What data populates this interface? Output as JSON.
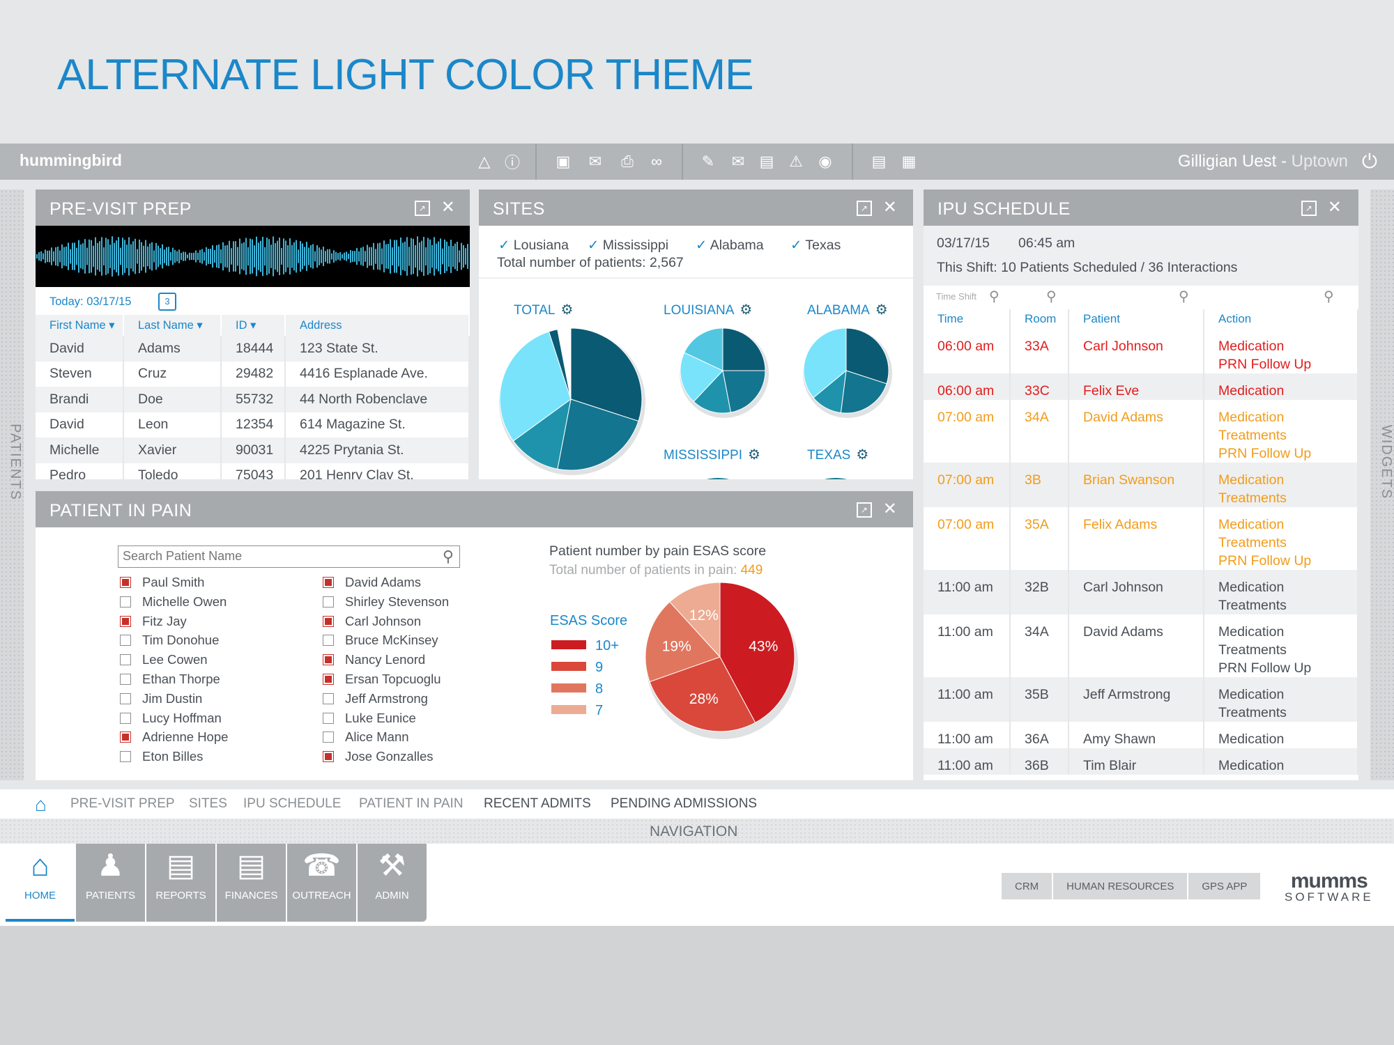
{
  "slide_title": "ALTERNATE LIGHT COLOR THEME",
  "app": {
    "brand": "hummingbird",
    "user": "Gilligian Uest",
    "separator": " - ",
    "location": "Uptown"
  },
  "side_tabs": {
    "left": "PATIENTS",
    "right": "WIDGETS"
  },
  "previsit": {
    "title": "PRE-VISIT PREP",
    "today": "Today: 03/17/15",
    "calendar_day": "3",
    "columns": [
      "First Name ▾",
      "Last Name ▾",
      "ID ▾",
      "Address"
    ],
    "rows": [
      [
        "David",
        "Adams",
        "18444",
        "123 State St."
      ],
      [
        "Steven",
        "Cruz",
        "29482",
        "4416 Esplanade Ave."
      ],
      [
        "Brandi",
        "Doe",
        "55732",
        "44 North Robenclave"
      ],
      [
        "David",
        "Leon",
        "12354",
        "614 Magazine St."
      ],
      [
        "Michelle",
        "Xavier",
        "90031",
        "4225 Prytania St."
      ],
      [
        "Pedro",
        "Toledo",
        "75043",
        "201 Henry Clay St."
      ]
    ]
  },
  "sites": {
    "title": "SITES",
    "filters": [
      "Lousiana",
      "Mississippi",
      "Alabama",
      "Texas"
    ],
    "total": "Total number of patients: 2,567",
    "charts": [
      "TOTAL",
      "LOUISIANA",
      "ALABAMA",
      "MISSISSIPPI",
      "TEXAS"
    ]
  },
  "ipu": {
    "title": "IPU SCHEDULE",
    "date": "03/17/15",
    "time": "06:45 am",
    "shift": "This Shift: 10 Patients Scheduled / 36 Interactions",
    "time_shift_placeholder": "Time Shift",
    "columns": [
      "Time",
      "Room",
      "Patient",
      "Action"
    ],
    "rows": [
      {
        "time": "06:00 am",
        "room": "33A",
        "patient": "Carl Johnson",
        "actions": [
          "Medication",
          "PRN Follow Up"
        ],
        "status": "red"
      },
      {
        "time": "06:00 am",
        "room": "33C",
        "patient": "Felix Eve",
        "actions": [
          "Medication"
        ],
        "status": "red"
      },
      {
        "time": "07:00 am",
        "room": "34A",
        "patient": "David Adams",
        "actions": [
          "Medication",
          "Treatments",
          "PRN Follow Up"
        ],
        "status": "orange"
      },
      {
        "time": "07:00 am",
        "room": "3B",
        "patient": "Brian Swanson",
        "actions": [
          "Medication",
          "Treatments"
        ],
        "status": "orange"
      },
      {
        "time": "07:00 am",
        "room": "35A",
        "patient": "Felix Adams",
        "actions": [
          "Medication",
          "Treatments",
          "PRN Follow Up"
        ],
        "status": "orange"
      },
      {
        "time": "11:00 am",
        "room": "32B",
        "patient": "Carl Johnson",
        "actions": [
          "Medication",
          "Treatments"
        ],
        "status": "gray"
      },
      {
        "time": "11:00 am",
        "room": "34A",
        "patient": "David Adams",
        "actions": [
          "Medication",
          "Treatments",
          "PRN Follow Up"
        ],
        "status": "gray"
      },
      {
        "time": "11:00 am",
        "room": "35B",
        "patient": "Jeff Armstrong",
        "actions": [
          "Medication",
          "Treatments"
        ],
        "status": "gray"
      },
      {
        "time": "11:00 am",
        "room": "36A",
        "patient": "Amy Shawn",
        "actions": [
          "Medication"
        ],
        "status": "gray"
      },
      {
        "time": "11:00 am",
        "room": "36B",
        "patient": "Tim Blair",
        "actions": [
          "Medication"
        ],
        "status": "gray"
      }
    ]
  },
  "pain": {
    "title": "PATIENT IN PAIN",
    "search_placeholder": "Search Patient Name",
    "patients_left": [
      {
        "name": "Paul Smith",
        "checked": true
      },
      {
        "name": "Michelle Owen",
        "checked": false
      },
      {
        "name": "Fitz Jay",
        "checked": true
      },
      {
        "name": "Tim Donohue",
        "checked": false
      },
      {
        "name": "Lee Cowen",
        "checked": false
      },
      {
        "name": "Ethan Thorpe",
        "checked": false
      },
      {
        "name": "Jim Dustin",
        "checked": false
      },
      {
        "name": "Lucy Hoffman",
        "checked": false
      },
      {
        "name": "Adrienne Hope",
        "checked": true
      },
      {
        "name": "Eton Billes",
        "checked": false
      }
    ],
    "patients_right": [
      {
        "name": "David Adams",
        "checked": true
      },
      {
        "name": "Shirley Stevenson",
        "checked": false
      },
      {
        "name": "Carl Johnson",
        "checked": true
      },
      {
        "name": "Bruce McKinsey",
        "checked": false
      },
      {
        "name": "Nancy Lenord",
        "checked": true
      },
      {
        "name": "Ersan Topcuoglu",
        "checked": true
      },
      {
        "name": "Jeff Armstrong",
        "checked": false
      },
      {
        "name": "Luke Eunice",
        "checked": false
      },
      {
        "name": "Alice Mann",
        "checked": false
      },
      {
        "name": "Jose Gonzalles",
        "checked": true
      }
    ],
    "chart_title": "Patient number by pain ESAS score",
    "total_label": "Total number of patients in pain: ",
    "total_value": "449",
    "legend_title": "ESAS Score"
  },
  "chart_data": [
    {
      "type": "pie",
      "title": "TOTAL",
      "series": [
        {
          "values": [
            30,
            23,
            12,
            30,
            2,
            3
          ]
        }
      ],
      "colors": [
        "#0b5a73",
        "#13758f",
        "#1f93ab",
        "#79e3fb",
        "#0b5a73",
        "#ffffff"
      ]
    },
    {
      "type": "pie",
      "title": "LOUISIANA",
      "series": [
        {
          "values": [
            25,
            22,
            15,
            20,
            18
          ]
        }
      ],
      "colors": [
        "#0b5a73",
        "#13758f",
        "#1f93ab",
        "#79e3fb",
        "#52c7e2"
      ]
    },
    {
      "type": "pie",
      "title": "ALABAMA",
      "series": [
        {
          "values": [
            30,
            22,
            12,
            36
          ]
        }
      ],
      "colors": [
        "#0b5a73",
        "#13758f",
        "#1f93ab",
        "#79e3fb"
      ]
    },
    {
      "type": "pie",
      "title": "",
      "categories": [
        "10+",
        "9",
        "8",
        "7"
      ],
      "series": [
        {
          "values": [
            43,
            28,
            19,
            12
          ]
        }
      ],
      "labels": [
        "43%",
        "28%",
        "19%",
        "12%"
      ],
      "colors": [
        "#cc1c22",
        "#d9483a",
        "#e1765e",
        "#ecab92"
      ]
    }
  ],
  "tabs": [
    "PRE-VISIT PREP",
    "SITES",
    "IPU SCHEDULE",
    "PATIENT IN PAIN",
    "RECENT ADMITS",
    "PENDING ADMISSIONS"
  ],
  "navigation_label": "NAVIGATION",
  "nav": [
    "HOME",
    "PATIENTS",
    "REPORTS",
    "FINANCES",
    "OUTREACH",
    "ADMIN"
  ],
  "apps": [
    "CRM",
    "HUMAN RESOURCES",
    "GPS APP"
  ],
  "logo": {
    "line1": "mumms",
    "line2": "SOFTWARE"
  }
}
